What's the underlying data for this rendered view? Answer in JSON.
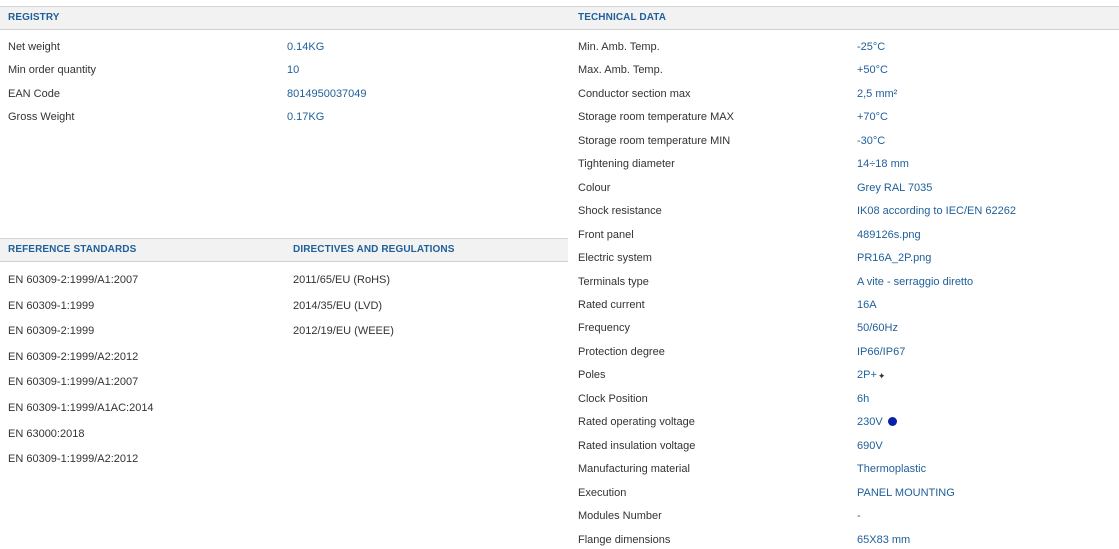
{
  "registry": {
    "title": "REGISTRY",
    "rows": [
      {
        "label": "Net weight",
        "value": "0.14KG"
      },
      {
        "label": "Min order quantity",
        "value": "10"
      },
      {
        "label": "EAN Code",
        "value": "8014950037049"
      },
      {
        "label": "Gross Weight",
        "value": "0.17KG"
      }
    ]
  },
  "reference_standards": {
    "title": "REFERENCE STANDARDS",
    "items": [
      "EN 60309-2:1999/A1:2007",
      "EN 60309-1:1999",
      "EN 60309-2:1999",
      "EN 60309-2:1999/A2:2012",
      "EN 60309-1:1999/A1:2007",
      "EN 60309-1:1999/A1AC:2014",
      "EN 63000:2018",
      "EN 60309-1:1999/A2:2012"
    ]
  },
  "directives": {
    "title": "DIRECTIVES AND REGULATIONS",
    "items": [
      "2011/65/EU (RoHS)",
      "2014/35/EU (LVD)",
      "2012/19/EU (WEEE)"
    ]
  },
  "technical": {
    "title": "TECHNICAL DATA",
    "rows": [
      {
        "label": "Min. Amb. Temp.",
        "value": "-25°C"
      },
      {
        "label": "Max. Amb. Temp.",
        "value": "+50°C"
      },
      {
        "label": "Conductor section max",
        "value": "2,5 mm²"
      },
      {
        "label": "Storage room temperature MAX",
        "value": "+70°C"
      },
      {
        "label": "Storage room temperature MIN",
        "value": "-30°C"
      },
      {
        "label": "Tightening diameter",
        "value": "14÷18 mm"
      },
      {
        "label": "Colour",
        "value": "Grey RAL 7035"
      },
      {
        "label": "Shock resistance",
        "value": "IK08 according to IEC/EN 62262"
      },
      {
        "label": "Front panel",
        "value": "489126s.png"
      },
      {
        "label": "Electric system",
        "value": "PR16A_2P.png"
      },
      {
        "label": "Terminals type",
        "value": "A vite - serraggio diretto"
      },
      {
        "label": "Rated current",
        "value": "16A"
      },
      {
        "label": "Frequency",
        "value": "50/60Hz"
      },
      {
        "label": "Protection degree",
        "value": "IP66/IP67"
      },
      {
        "label": "Poles",
        "value": "2P+"
      },
      {
        "label": "Clock Position",
        "value": "6h"
      },
      {
        "label": "Rated operating voltage",
        "value": "230V"
      },
      {
        "label": "Rated insulation voltage",
        "value": "690V"
      },
      {
        "label": "Manufacturing material",
        "value": "Thermoplastic"
      },
      {
        "label": "Execution",
        "value": "PANEL MOUNTING"
      },
      {
        "label": "Modules Number",
        "value": "-"
      },
      {
        "label": "Flange dimensions",
        "value": "65X83 mm"
      }
    ]
  },
  "voltage_dot_color": "#0a20a8",
  "accent_color": "#1f5f9a"
}
